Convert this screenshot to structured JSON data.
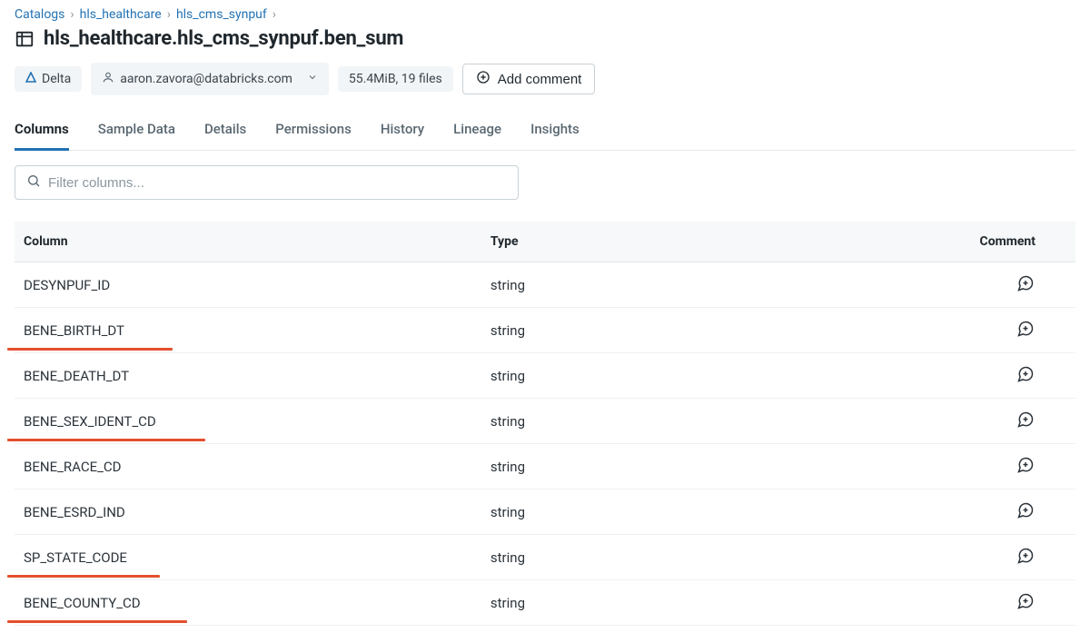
{
  "breadcrumb": {
    "items": [
      "Catalogs",
      "hls_healthcare",
      "hls_cms_synpuf"
    ]
  },
  "title": "hls_healthcare.hls_cms_synpuf.ben_sum",
  "chips": {
    "format_label": "Delta",
    "owner": "aaron.zavora@databricks.com",
    "size_label": "55.4MiB, 19 files",
    "add_comment_label": "Add comment"
  },
  "tabs": [
    {
      "label": "Columns",
      "active": true
    },
    {
      "label": "Sample Data",
      "active": false
    },
    {
      "label": "Details",
      "active": false
    },
    {
      "label": "Permissions",
      "active": false
    },
    {
      "label": "History",
      "active": false
    },
    {
      "label": "Lineage",
      "active": false
    },
    {
      "label": "Insights",
      "active": false
    }
  ],
  "filter": {
    "placeholder": "Filter columns..."
  },
  "columns_table": {
    "headers": {
      "column": "Column",
      "type": "Type",
      "comment": "Comment"
    },
    "rows": [
      {
        "name": "DESYNPUF_ID",
        "type": "string",
        "highlight": false,
        "uw": 0
      },
      {
        "name": "BENE_BIRTH_DT",
        "type": "string",
        "highlight": true,
        "uw": 182
      },
      {
        "name": "BENE_DEATH_DT",
        "type": "string",
        "highlight": false,
        "uw": 0
      },
      {
        "name": "BENE_SEX_IDENT_CD",
        "type": "string",
        "highlight": true,
        "uw": 218
      },
      {
        "name": "BENE_RACE_CD",
        "type": "string",
        "highlight": false,
        "uw": 0
      },
      {
        "name": "BENE_ESRD_IND",
        "type": "string",
        "highlight": false,
        "uw": 0
      },
      {
        "name": "SP_STATE_CODE",
        "type": "string",
        "highlight": true,
        "uw": 168
      },
      {
        "name": "BENE_COUNTY_CD",
        "type": "string",
        "highlight": true,
        "uw": 198
      }
    ]
  }
}
